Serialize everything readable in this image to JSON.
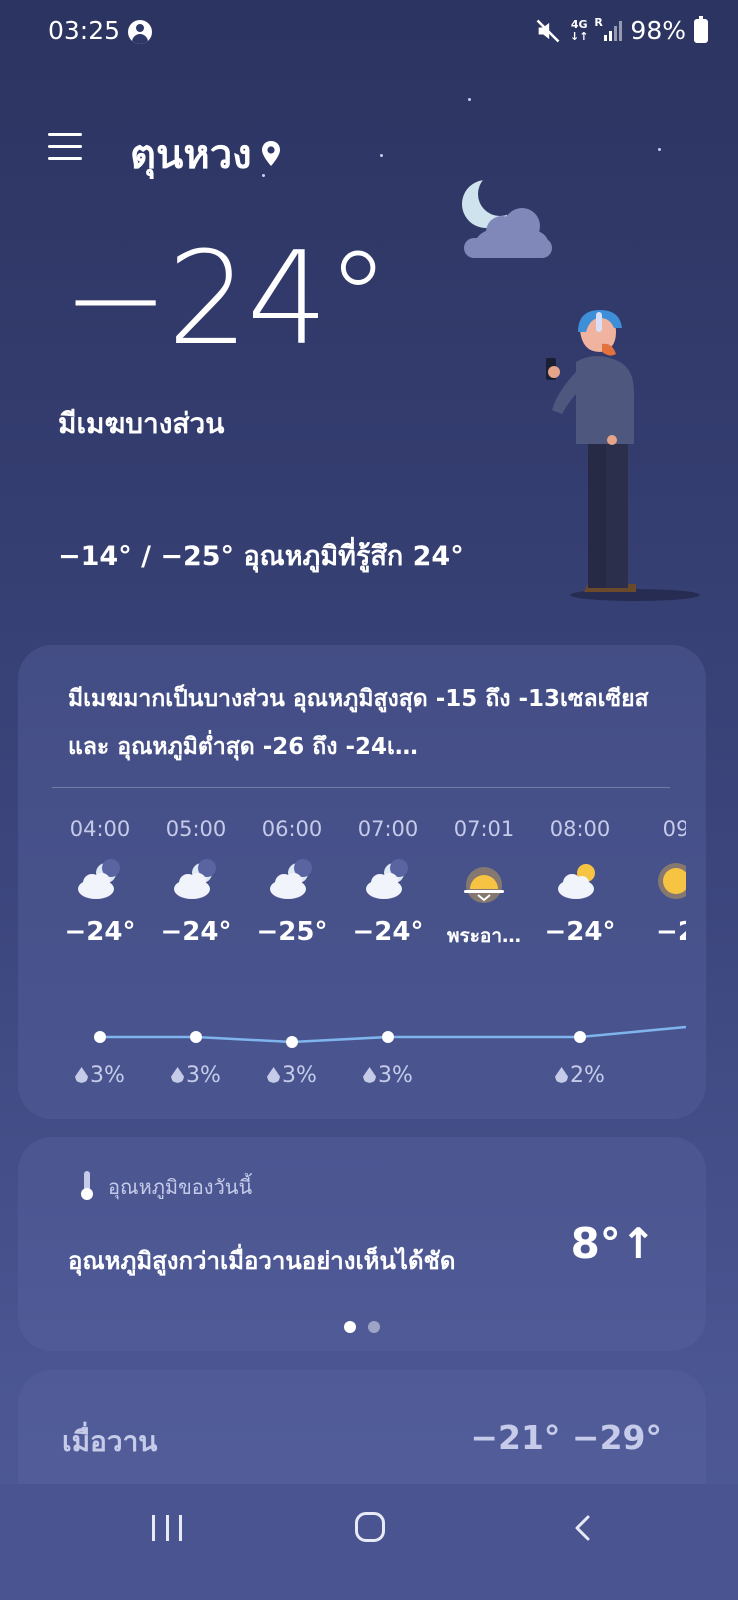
{
  "status_bar": {
    "time": "03:25",
    "network_top": "4G",
    "network_bottom": "↓↑",
    "roaming": "R",
    "battery": "98%"
  },
  "location": {
    "name": "ตุนหวง"
  },
  "current": {
    "temperature": "−24°",
    "condition": "มีเมฆบางส่วน",
    "high_low_feels": "−14° / −25° อุณหภูมิที่รู้สึก 24°"
  },
  "forecast": {
    "summary": "มีเมฆมากเป็นบางส่วน อุณหภูมิสูงสุด -15 ถึง -13เซลเซียส และ อุณหภูมิต่ำสุด -26 ถึง -24เ…",
    "hours": [
      {
        "time": "04:00",
        "icon": "moon-cloud-icon",
        "temp": "−24°",
        "precip": "3%"
      },
      {
        "time": "05:00",
        "icon": "moon-cloud-icon",
        "temp": "−24°",
        "precip": "3%"
      },
      {
        "time": "06:00",
        "icon": "moon-cloud-icon",
        "temp": "−25°",
        "precip": "3%"
      },
      {
        "time": "07:00",
        "icon": "moon-cloud-icon",
        "temp": "−24°",
        "precip": "3%"
      },
      {
        "time": "07:01",
        "icon": "sunrise-icon",
        "temp": "พระอา…",
        "precip": ""
      },
      {
        "time": "08:00",
        "icon": "sun-cloud-icon",
        "temp": "−24°",
        "precip": "2%"
      },
      {
        "time": "09",
        "icon": "sun-icon",
        "temp": "−2",
        "precip": ""
      }
    ]
  },
  "today": {
    "label": "อุณหภูมิของวันนี้",
    "text": "อุณหภูมิสูงกว่าเมื่อวานอย่างเห็นได้ชัด",
    "value": "8°↑"
  },
  "yesterday": {
    "label": "เมื่อวาน",
    "value": "−21° −29°"
  },
  "colors": {
    "background_top": "#2c3461",
    "background_bottom": "#4f5a96",
    "card": "#5a64a0",
    "temp_line": "#7fb4ee",
    "secondary_text": "#c6cbea",
    "sun": "#f6c343"
  }
}
